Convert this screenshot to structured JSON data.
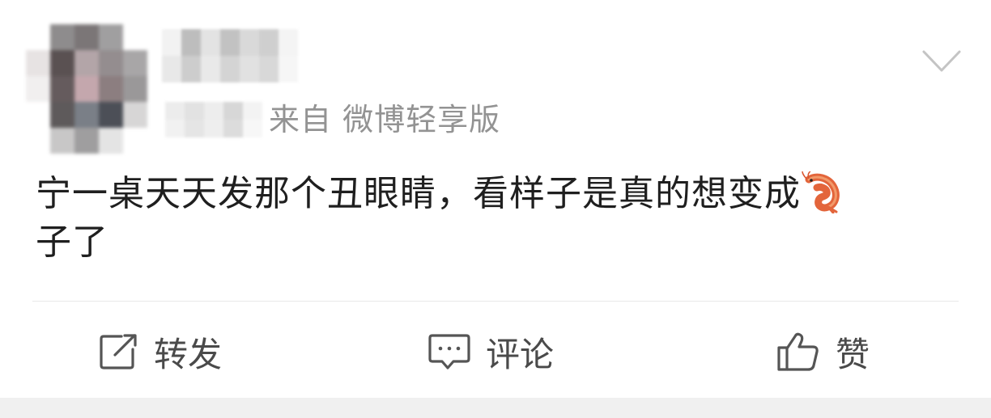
{
  "post": {
    "source_prefix": "来自",
    "source_app": "微博轻享版",
    "text_line1": "宁一桌天天发那个丑眼睛，看样子是真的想变成",
    "text_line2": "子了",
    "emoji_icon": "shrimp-icon"
  },
  "actions": {
    "repost_label": "转发",
    "comment_label": "评论",
    "like_label": "赞"
  },
  "colors": {
    "text": "#1f1f1f",
    "meta": "#939393",
    "action": "#4a4a4a",
    "divider": "#e8e8e8",
    "bottom_band": "#f0f0f0"
  }
}
